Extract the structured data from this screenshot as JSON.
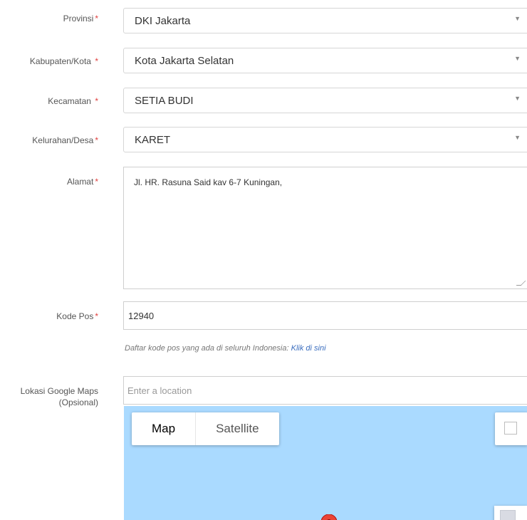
{
  "form": {
    "provinsi": {
      "label": "Provinsi",
      "required": "*",
      "value": "DKI Jakarta"
    },
    "kabupaten": {
      "label": "Kabupaten/Kota",
      "required": "*",
      "value": "Kota Jakarta Selatan"
    },
    "kecamatan": {
      "label": "Kecamatan",
      "required": "*",
      "value": "SETIA BUDI"
    },
    "kelurahan": {
      "label": "Kelurahan/Desa",
      "required": "*",
      "value": "KARET"
    },
    "alamat": {
      "label": "Alamat",
      "required": "*",
      "value": "Jl. HR. Rasuna Said kav 6-7 Kuningan,"
    },
    "kodepos": {
      "label": "Kode Pos",
      "required": "*",
      "value": "12940",
      "help_text": "Daftar kode pos yang ada di seluruh Indonesia: ",
      "help_link": "Klik di sini"
    },
    "maps": {
      "label_line1": "Lokasi Google Maps",
      "label_line2": "(Opsional)",
      "placeholder": "Enter a location"
    }
  },
  "map": {
    "type_buttons": [
      "Map",
      "Satellite"
    ],
    "active": "Map",
    "water_color": "#aadaff",
    "pin_color": "#ea4335"
  },
  "icons": {
    "select_arrow": "caret-down-icon",
    "map_pin": "map-marker-icon",
    "fullscreen": "fullscreen-icon",
    "pegman": "street-view-icon"
  },
  "colors": {
    "required": "#e0413f",
    "link": "#3b6ebf",
    "border": "#d6d6d6"
  }
}
